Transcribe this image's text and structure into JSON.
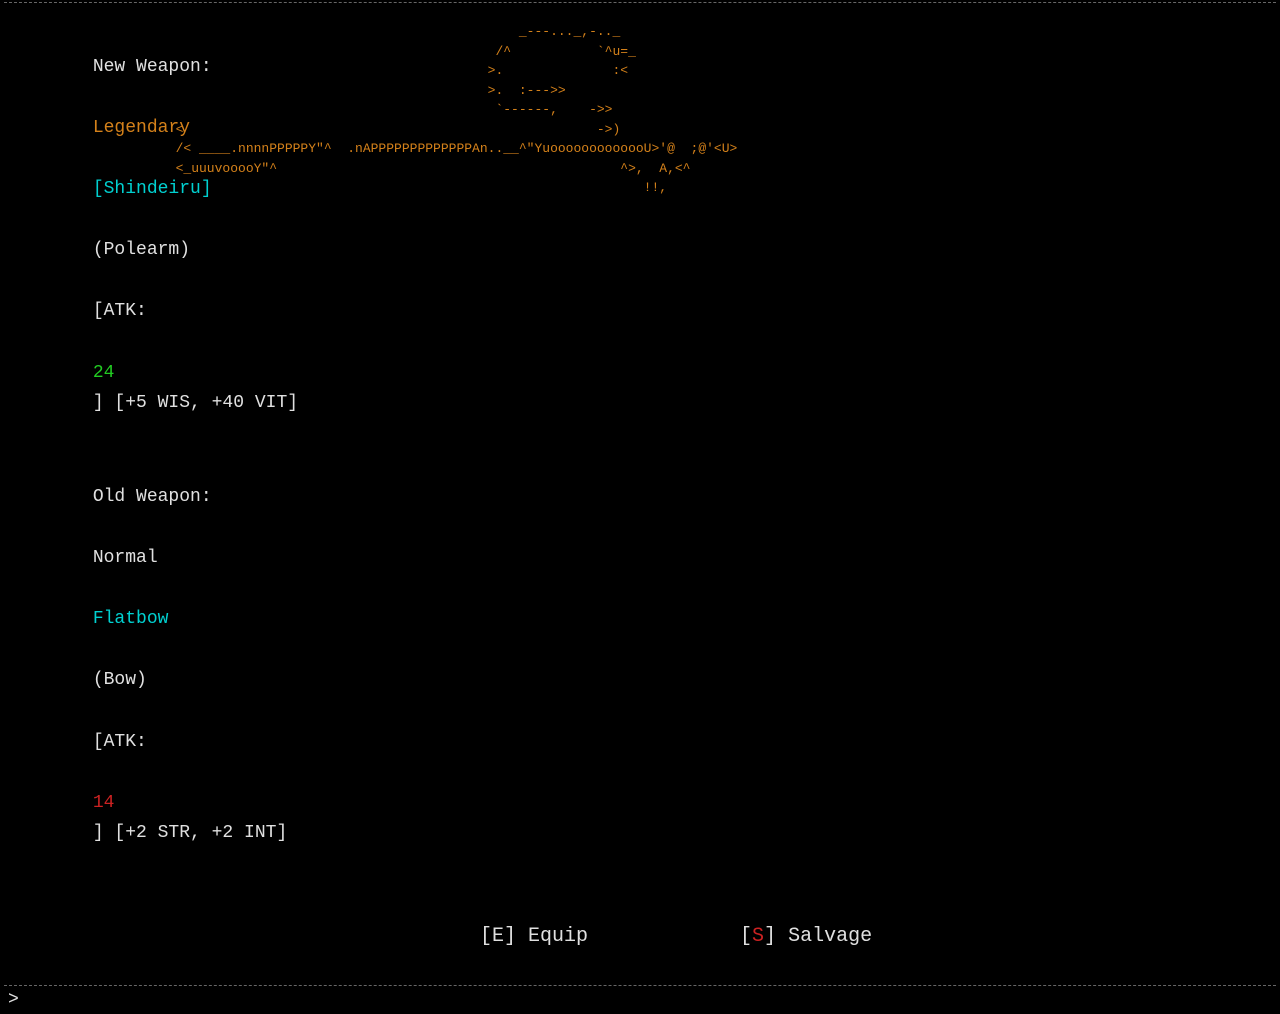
{
  "dividers": {
    "char": "-",
    "corner": "+"
  },
  "ascii_art": {
    "line1": "                                           _---..._,-.._",
    "line2": "                                          /^         ^u=",
    "line3": "                                         >.           :<",
    "line4": "                                         >. :--->>",
    "line5": "                                          `-----,   ->>",
    "line6": "  <                                                  ->)",
    "line7": "  /< ____.nnnnPPPPPY\"^  .nAPPPPPPPPPPPPPAn..__^\"YuooooooooooooU>'@  ;@'<U>",
    "line8": "  <_uuuvoooY\"^                                              ^>. A,<^",
    "line9": "                                                               !!,"
  },
  "weapon_comparison": {
    "new_weapon": {
      "label": "New Weapon:",
      "rarity": "Legendary",
      "name": "[Shindeiru]",
      "type": "(Polearm)",
      "atk_label": "[ATK:",
      "atk_value": "24",
      "stats": "] [+5 WIS, +40 VIT]"
    },
    "old_weapon": {
      "label": "Old Weapon:",
      "rarity": "Normal",
      "name": "Flatbow",
      "type": "(Bow)",
      "atk_label": "[ATK:",
      "atk_value": "14",
      "stats": "] [+2 STR, +2 INT]"
    }
  },
  "actions": {
    "equip": "[E] Equip",
    "salvage": "[S] Salvage"
  },
  "prompt": {
    "symbol": ">"
  }
}
